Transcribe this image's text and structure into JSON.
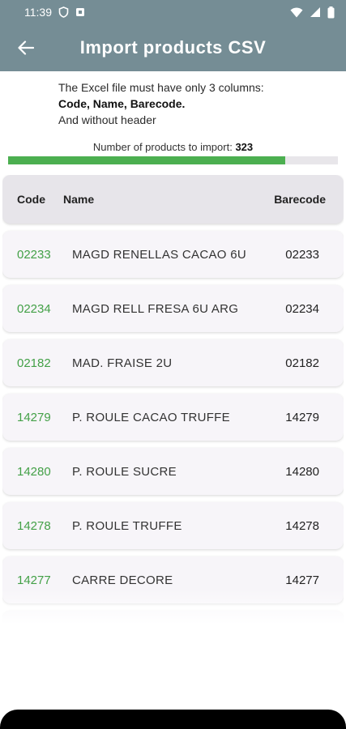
{
  "status_bar": {
    "time": "11:39"
  },
  "header": {
    "title": "Import products CSV"
  },
  "info": {
    "line1": "The Excel file must have only 3 columns:",
    "line2": "Code, Name, Barecode.",
    "line3": "And without header"
  },
  "import_count": {
    "label": "Number of products to import: ",
    "value": "323",
    "progress_fraction": 0.84
  },
  "colors": {
    "app_bar": "#758d95",
    "accent_green": "#4caf50",
    "code_text": "#43a047"
  },
  "table": {
    "headers": {
      "code": "Code",
      "name": "Name",
      "barecode": "Barecode"
    },
    "rows": [
      {
        "code": "02233",
        "name": "MAGD RENELLAS CACAO 6U",
        "barecode": "02233"
      },
      {
        "code": "02234",
        "name": "MAGD RELL FRESA 6U ARG",
        "barecode": "02234"
      },
      {
        "code": "02182",
        "name": "MAD. FRAISE 2U",
        "barecode": "02182"
      },
      {
        "code": "14279",
        "name": "P. ROULE CACAO TRUFFE",
        "barecode": "14279"
      },
      {
        "code": "14280",
        "name": "P. ROULE SUCRE",
        "barecode": "14280"
      },
      {
        "code": "14278",
        "name": "P. ROULE TRUFFE",
        "barecode": "14278"
      },
      {
        "code": "14277",
        "name": "CARRE DECORE",
        "barecode": "14277"
      }
    ]
  }
}
